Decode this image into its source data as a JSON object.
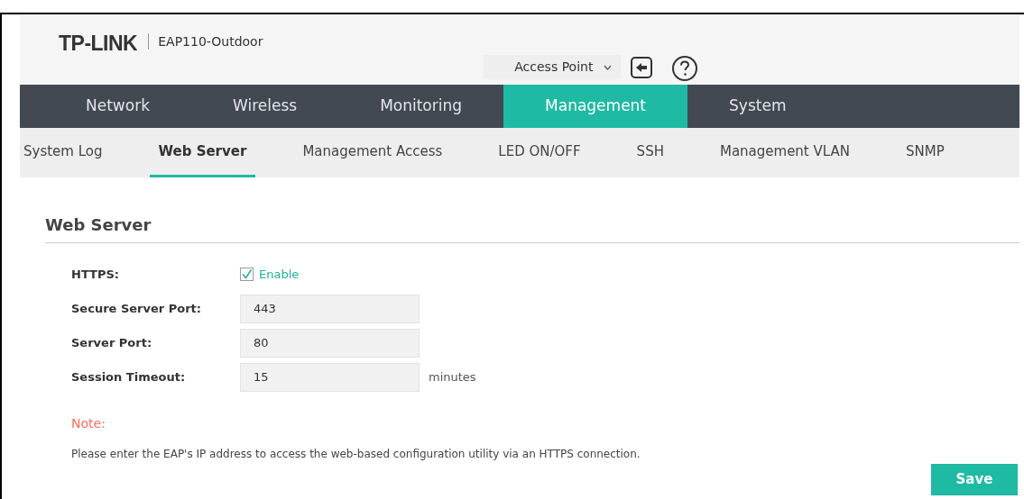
{
  "header": {
    "brand": "TP-LINK",
    "device": "EAP110-Outdoor",
    "mode": "Access Point"
  },
  "tabs": [
    {
      "label": "Network",
      "selected": false
    },
    {
      "label": "Wireless",
      "selected": false
    },
    {
      "label": "Monitoring",
      "selected": false
    },
    {
      "label": "Management",
      "selected": true
    },
    {
      "label": "System",
      "selected": false
    }
  ],
  "subtabs": [
    {
      "label": "System Log",
      "selected": false
    },
    {
      "label": "Web Server",
      "selected": true
    },
    {
      "label": "Management Access",
      "selected": false
    },
    {
      "label": "LED ON/OFF",
      "selected": false
    },
    {
      "label": "SSH",
      "selected": false
    },
    {
      "label": "Management VLAN",
      "selected": false
    },
    {
      "label": "SNMP",
      "selected": false
    }
  ],
  "section": {
    "title": "Web Server"
  },
  "fields": [
    {
      "kind": "checkbox",
      "label": "HTTPS:",
      "option": "Enable",
      "checked": true
    },
    {
      "kind": "input",
      "label": "Secure Server Port:",
      "value": "443"
    },
    {
      "kind": "input",
      "label": "Server Port:",
      "value": "80"
    },
    {
      "kind": "input",
      "label": "Session Timeout:",
      "value": "15",
      "unit": "minutes"
    }
  ],
  "note": {
    "title": "Note:",
    "text": "Please enter the EAP's IP address to access the web-based configuration utility via an HTTPS connection."
  },
  "buttons": [
    "Save"
  ]
}
